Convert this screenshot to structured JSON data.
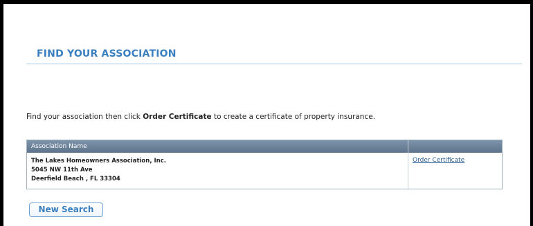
{
  "header": {
    "title": "FIND YOUR ASSOCIATION"
  },
  "intro": {
    "before": "Find your association then click ",
    "emphasis": "Order Certificate",
    "after": " to create a certificate of property insurance."
  },
  "table": {
    "columns": [
      "Association Name",
      ""
    ],
    "rows": [
      {
        "name": "The Lakes Homeowners Association, Inc.",
        "address": "5045 NW 11th Ave",
        "city_state_zip": "Deerfield Beach , FL 33304",
        "action_label": "Order Certificate"
      }
    ]
  },
  "actions": {
    "new_search_label": "New Search"
  },
  "colors": {
    "accent": "#3a7fbf",
    "table_header": "#6a8199",
    "link": "#2b5f93"
  }
}
